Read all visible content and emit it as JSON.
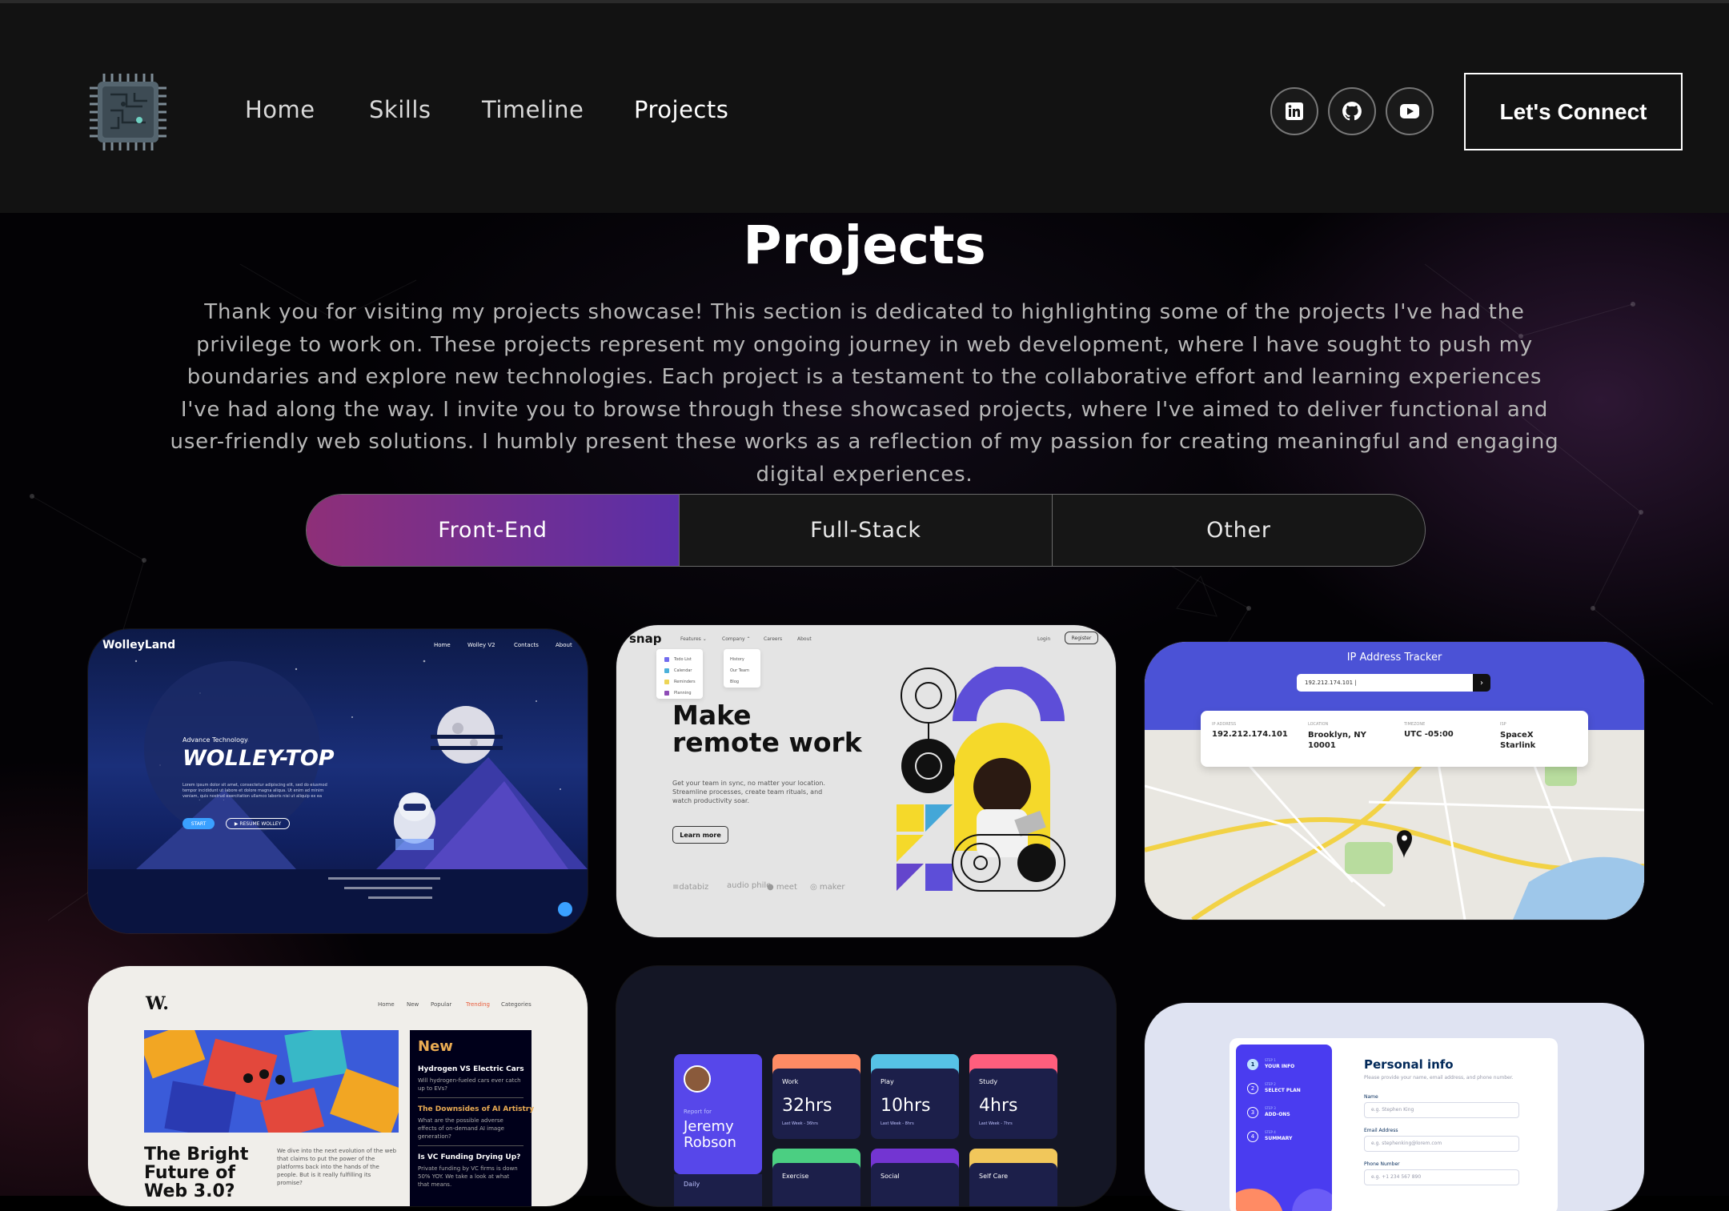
{
  "nav": {
    "links": [
      "Home",
      "Skills",
      "Timeline",
      "Projects"
    ],
    "active": "Projects",
    "social_icons": [
      "linkedin-icon",
      "github-icon",
      "youtube-icon"
    ],
    "connect_label": "Let's Connect"
  },
  "section": {
    "title": "Projects",
    "intro": "Thank you for visiting my projects showcase! This section is dedicated to highlighting some of the projects I've had the privilege to work on. These projects represent my ongoing journey in web development, where I have sought to push my boundaries and explore new technologies. Each project is a testament to the collaborative effort and learning experiences I've had along the way. I invite you to browse through these showcased projects, where I've aimed to deliver functional and user-friendly web solutions. I humbly present these works as a reflection of my passion for creating meaningful and engaging digital experiences."
  },
  "tabs": [
    {
      "label": "Front-End",
      "active": true
    },
    {
      "label": "Full-Stack",
      "active": false
    },
    {
      "label": "Other",
      "active": false
    }
  ],
  "cards": {
    "wolley": {
      "brand": "WolleyLand",
      "nav": [
        "Home",
        "Wolley V2",
        "Contacts",
        "About"
      ],
      "eyebrow": "Advance Technology",
      "headline": "WOLLEY-TOP",
      "body": "Lorem ipsum dolor sit amet, consectetur adipiscing elit, sed do eiusmod tempor incididunt ut labore et dolore magna aliqua. Ut enim ad minim veniam, quis nostrud exercitation ullamco laboris nisi ut aliquip ex ea commodo consequat.",
      "start": "START",
      "resume": "▶ RESUME WOLLEY"
    },
    "snap": {
      "brand": "snap",
      "nav": [
        "Features ⌄",
        "Company ⌃",
        "Careers",
        "About"
      ],
      "login": "Login",
      "register": "Register",
      "features_menu": [
        "Todo List",
        "Calendar",
        "Reminders",
        "Planning"
      ],
      "company_menu": [
        "History",
        "Our Team",
        "Blog"
      ],
      "headline_1": "Make",
      "headline_2": "remote work",
      "body": "Get your team in sync, no matter your location. Streamline processes, create team rituals, and watch productivity soar.",
      "cta": "Learn more",
      "clients": [
        "≡databiz",
        "audio phile",
        "● meet",
        "◎ maker"
      ]
    },
    "ip": {
      "title": "IP Address Tracker",
      "input": "192.212.174.101 |",
      "fields": [
        {
          "label": "IP ADDRESS",
          "value": "192.212.174.101"
        },
        {
          "label": "LOCATION",
          "value": "Brooklyn, NY 10001"
        },
        {
          "label": "TIMEZONE",
          "value": "UTC -05:00"
        },
        {
          "label": "ISP",
          "value": "SpaceX Starlink"
        }
      ]
    },
    "news": {
      "brand": "W.",
      "nav": [
        "Home",
        "New",
        "Popular",
        "Trending",
        "Categories"
      ],
      "new_heading": "New",
      "items": [
        {
          "title": "Hydrogen VS Electric Cars",
          "text": "Will hydrogen-fueled cars ever catch up to EVs?"
        },
        {
          "title": "The Downsides of AI Artistry",
          "text": "What are the possible adverse effects of on-demand AI image generation?"
        },
        {
          "title": "Is VC Funding Drying Up?",
          "text": "Private funding by VC firms is down 50% YOY. We take a look at what that means."
        }
      ],
      "headline": "The Bright Future of Web 3.0?",
      "body": "We dive into the next evolution of the web that claims to put the power of the platforms back into the hands of the people. But is it really fulfilling its promise?"
    },
    "tracker": {
      "report_for": "Report for",
      "name_1": "Jeremy",
      "name_2": "Robson",
      "period": "Daily",
      "tiles": [
        {
          "label": "Work",
          "value": "32hrs",
          "prev": "Last Week - 36hrs",
          "color": "#ff8b64"
        },
        {
          "label": "Play",
          "value": "10hrs",
          "prev": "Last Week - 8hrs",
          "color": "#56c2e6"
        },
        {
          "label": "Study",
          "value": "4hrs",
          "prev": "Last Week - 7hrs",
          "color": "#ff5e7d"
        },
        {
          "label": "Exercise",
          "color": "#4bcf82"
        },
        {
          "label": "Social",
          "color": "#7335d2"
        },
        {
          "label": "Self Care",
          "color": "#f1c75b"
        }
      ]
    },
    "form": {
      "steps": [
        {
          "num": "1",
          "step": "STEP 1",
          "label": "YOUR INFO"
        },
        {
          "num": "2",
          "step": "STEP 2",
          "label": "SELECT PLAN"
        },
        {
          "num": "3",
          "step": "STEP 3",
          "label": "ADD-ONS"
        },
        {
          "num": "4",
          "step": "STEP 4",
          "label": "SUMMARY"
        }
      ],
      "title": "Personal info",
      "subtitle": "Please provide your name, email address, and phone number.",
      "fields": [
        {
          "label": "Name",
          "placeholder": "e.g. Stephen King"
        },
        {
          "label": "Email Address",
          "placeholder": "e.g. stephenking@lorem.com"
        },
        {
          "label": "Phone Number",
          "placeholder": "e.g. +1 234 567 890"
        }
      ]
    }
  }
}
